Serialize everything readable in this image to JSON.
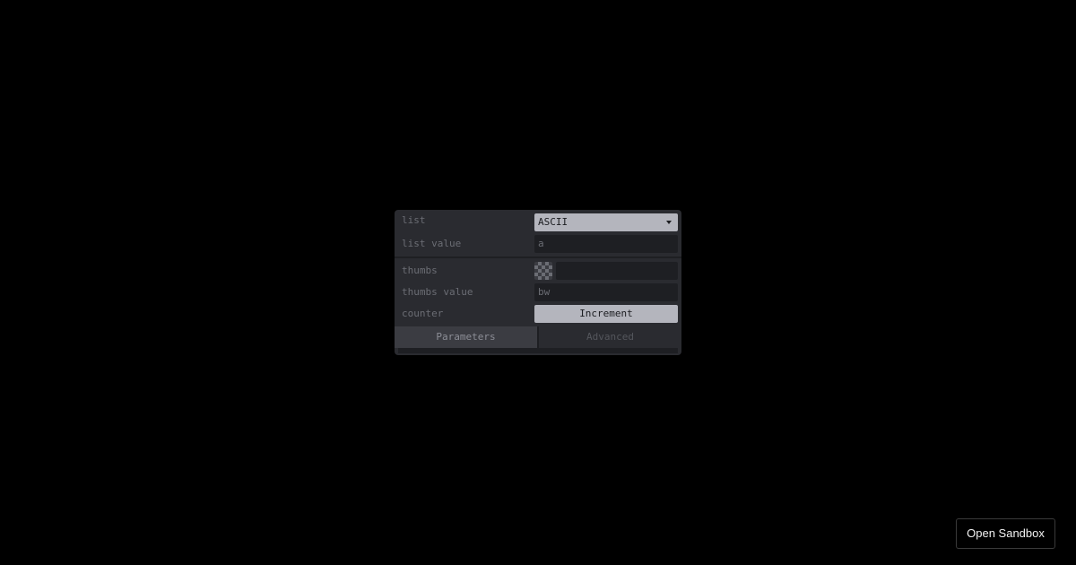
{
  "panel": {
    "rows": {
      "list": {
        "label": "list",
        "selected": "ASCII"
      },
      "list_value": {
        "label": "list value",
        "value": "a"
      },
      "thumbs": {
        "label": "thumbs",
        "value": ""
      },
      "thumbs_value": {
        "label": "thumbs value",
        "value": "bw"
      },
      "counter": {
        "label": "counter",
        "button_label": "Increment"
      }
    },
    "tabs": [
      {
        "label": "Parameters",
        "active": true
      },
      {
        "label": "Advanced",
        "active": false
      }
    ]
  },
  "sandbox_button": {
    "label": "Open Sandbox"
  },
  "colors": {
    "background": "#000000",
    "panel": "#2a2b30",
    "field": "#1e1f23",
    "accent": "#b4b5bd",
    "label": "#6b6d74"
  }
}
